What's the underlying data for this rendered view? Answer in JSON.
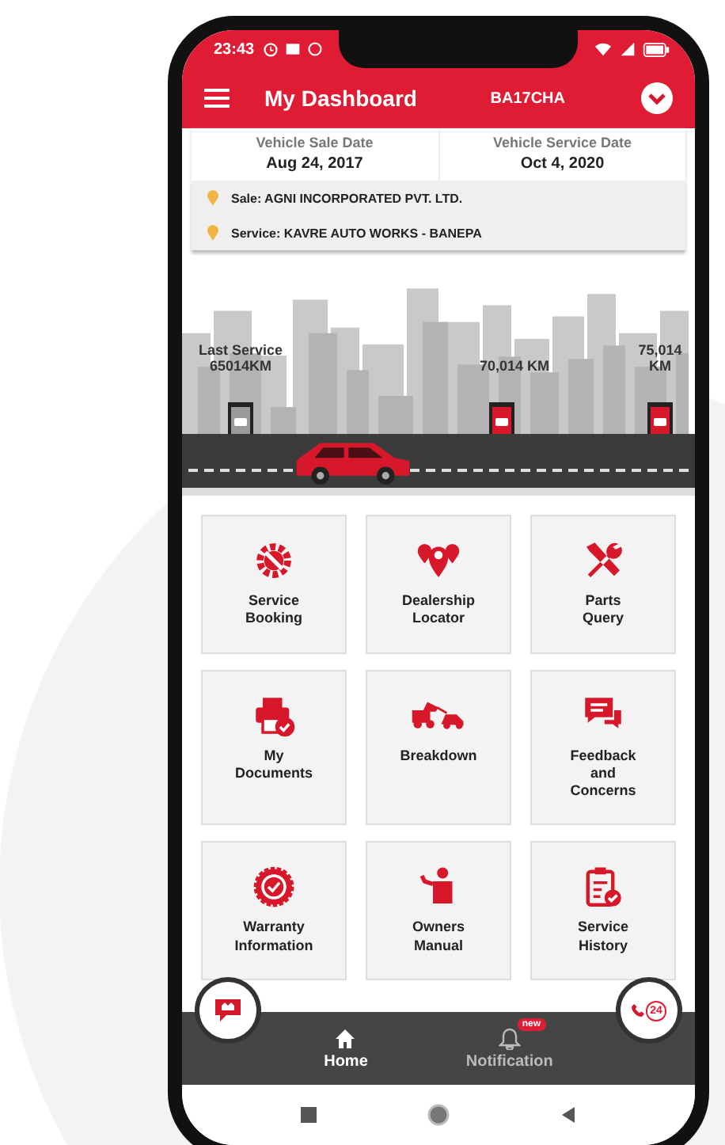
{
  "status_bar": {
    "time": "23:43"
  },
  "header": {
    "title": "My Dashboard",
    "vehicle": "BA17CHA"
  },
  "dates": [
    {
      "label": "Vehicle Sale Date",
      "value": "Aug 24, 2017"
    },
    {
      "label": "Vehicle Service Date",
      "value": "Oct 4, 2020"
    }
  ],
  "dealers": [
    {
      "text": "Sale: AGNI INCORPORATED PVT. LTD."
    },
    {
      "text": "Service: KAVRE AUTO WORKS - BANEPA"
    }
  ],
  "milestones": [
    {
      "label": "Last Service\n65014KM",
      "kind": "done"
    },
    {
      "label": "70,014 KM",
      "kind": "upcoming"
    },
    {
      "label": "75,014\nKM",
      "kind": "upcoming"
    }
  ],
  "tiles": [
    {
      "label": "Service\nBooking",
      "kind": "gear"
    },
    {
      "label": "Dealership\nLocator",
      "kind": "pins"
    },
    {
      "label": "Parts\nQuery",
      "kind": "tools"
    },
    {
      "label": "My\nDocuments",
      "kind": "printer"
    },
    {
      "label": "Breakdown",
      "kind": "tow"
    },
    {
      "label": "Feedback\nand\nConcerns",
      "kind": "chat"
    },
    {
      "label": "Warranty\nInformation",
      "kind": "badge"
    },
    {
      "label": "Owners\nManual",
      "kind": "person"
    },
    {
      "label": "Service\nHistory",
      "kind": "clipboard"
    }
  ],
  "nav": [
    {
      "label": "Home",
      "kind": "home",
      "selected": true
    },
    {
      "label": "Notification",
      "kind": "bell",
      "selected": false,
      "badge": "new"
    }
  ],
  "support": {
    "hours": "24"
  }
}
